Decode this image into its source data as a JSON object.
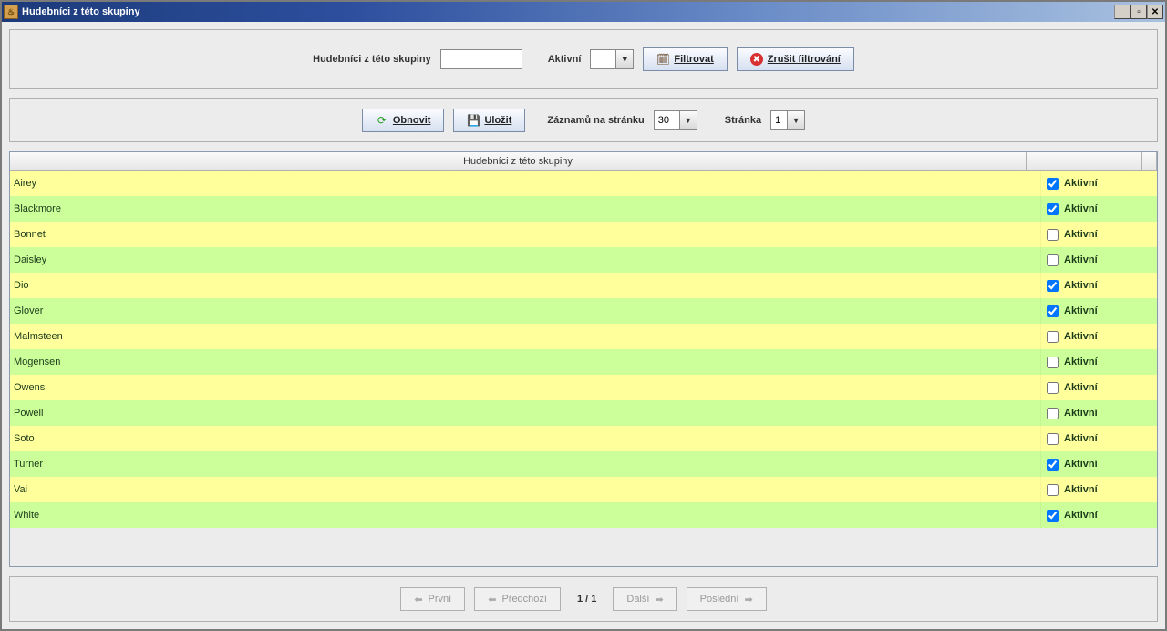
{
  "title": "Hudebníci z této skupiny",
  "filter": {
    "name_label": "Hudebníci z této skupiny",
    "name_value": "",
    "active_label": "Aktivní",
    "active_value": "",
    "filter_btn": "Filtrovat",
    "cancel_btn": "Zrušit filtrování"
  },
  "toolbar": {
    "refresh": "Obnovit",
    "save": "Uložit",
    "per_page_label": "Záznamů na stránku",
    "per_page_value": "30",
    "page_label": "Stránka",
    "page_value": "1"
  },
  "grid": {
    "header_name": "Hudebníci z této skupiny",
    "header_active": "",
    "active_col_label": "Aktivní",
    "rows": [
      {
        "name": "Airey",
        "active": true
      },
      {
        "name": "Blackmore",
        "active": true
      },
      {
        "name": "Bonnet",
        "active": false
      },
      {
        "name": "Daisley",
        "active": false
      },
      {
        "name": "Dio",
        "active": true
      },
      {
        "name": "Glover",
        "active": true
      },
      {
        "name": "Malmsteen",
        "active": false
      },
      {
        "name": "Mogensen",
        "active": false
      },
      {
        "name": "Owens",
        "active": false
      },
      {
        "name": "Powell",
        "active": false
      },
      {
        "name": "Soto",
        "active": false
      },
      {
        "name": "Turner",
        "active": true
      },
      {
        "name": "Vai",
        "active": false
      },
      {
        "name": "White",
        "active": true
      }
    ]
  },
  "pager": {
    "first": "První",
    "prev": "Předchozí",
    "info": "1 / 1",
    "next": "Další",
    "last": "Poslední"
  }
}
